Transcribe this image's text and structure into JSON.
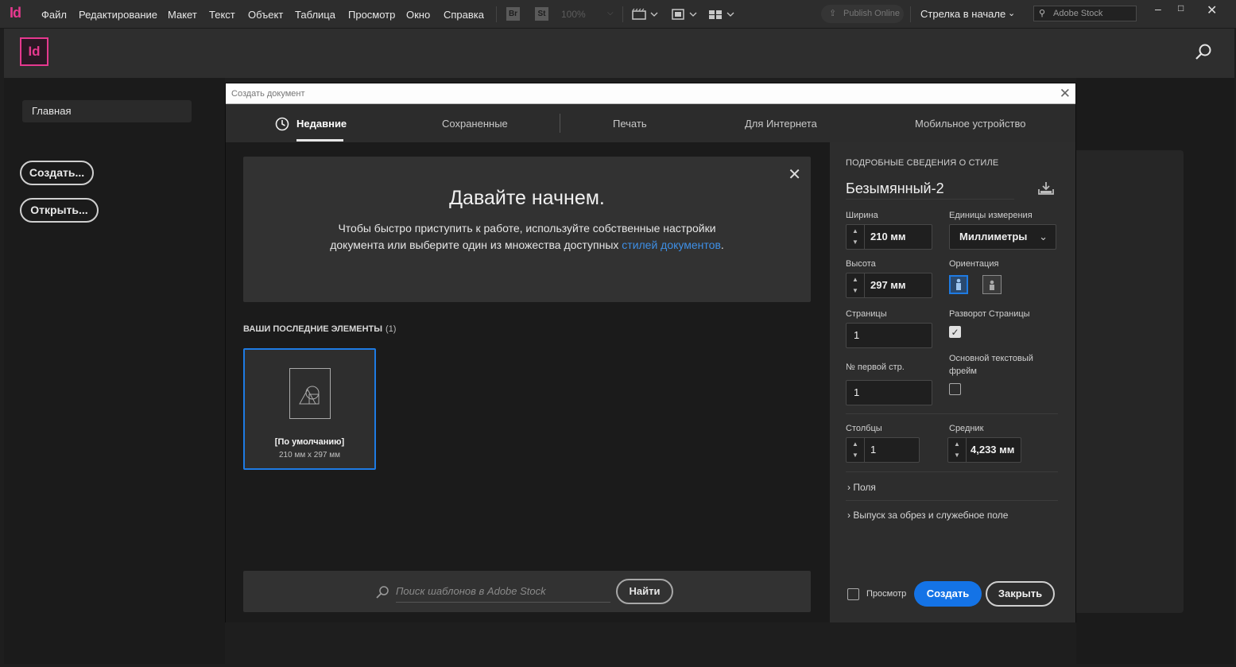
{
  "menubar": {
    "logo": "Id",
    "items": [
      "Файл",
      "Редактирование",
      "Макет",
      "Текст",
      "Объект",
      "Таблица",
      "Просмотр",
      "Окно",
      "Справка"
    ],
    "br": "Br",
    "st": "St",
    "zoom": "100%",
    "publish": "Publish Online",
    "arrow_label": "Стрелка в начале",
    "stock_placeholder": "Adobe Stock"
  },
  "home": {
    "logo": "Id",
    "nav_home": "Главная",
    "create_button": "Создать...",
    "open_button": "Открыть..."
  },
  "dialog": {
    "title": "Создать документ",
    "tabs": [
      "Недавние",
      "Сохраненные",
      "Печать",
      "Для Интернета",
      "Мобильное устройство"
    ],
    "welcome": {
      "heading": "Давайте начнем.",
      "text": "Чтобы быстро приступить к работе, используйте собственные настройки документа или выберите один из множества доступных ",
      "link": "стилей документов",
      "dot": "."
    },
    "recent": {
      "title": "ВАШИ ПОСЛЕДНИЕ ЭЛЕМЕНТЫ",
      "count": "(1)",
      "items": [
        {
          "name": "[По умолчанию]",
          "size": "210 мм x 297 мм"
        }
      ]
    },
    "stock_search": {
      "placeholder": "Поиск шаблонов в Adobe Stock",
      "button": "Найти"
    },
    "settings": {
      "header": "ПОДРОБНЫЕ СВЕДЕНИЯ О СТИЛЕ",
      "doc_name": "Безымянный-2",
      "width_label": "Ширина",
      "width_value": "210 мм",
      "units_label": "Единицы измерения",
      "units_value": "Миллиметры",
      "height_label": "Высота",
      "height_value": "297 мм",
      "orientation_label": "Ориентация",
      "pages_label": "Страницы",
      "pages_value": "1",
      "facing_label": "Разворот Страницы",
      "facing_checked": true,
      "first_page_label": "№ первой стр.",
      "first_page_value": "1",
      "primary_frame_label_1": "Основной текстовый",
      "primary_frame_label_2": "фрейм",
      "primary_frame_checked": false,
      "columns_label": "Столбцы",
      "columns_value": "1",
      "gutter_label": "Средник",
      "gutter_value": "4,233 мм",
      "margins": "Поля",
      "bleed": "Выпуск за обрез и служебное поле",
      "preview": "Просмотр",
      "create": "Создать",
      "close": "Закрыть"
    }
  }
}
